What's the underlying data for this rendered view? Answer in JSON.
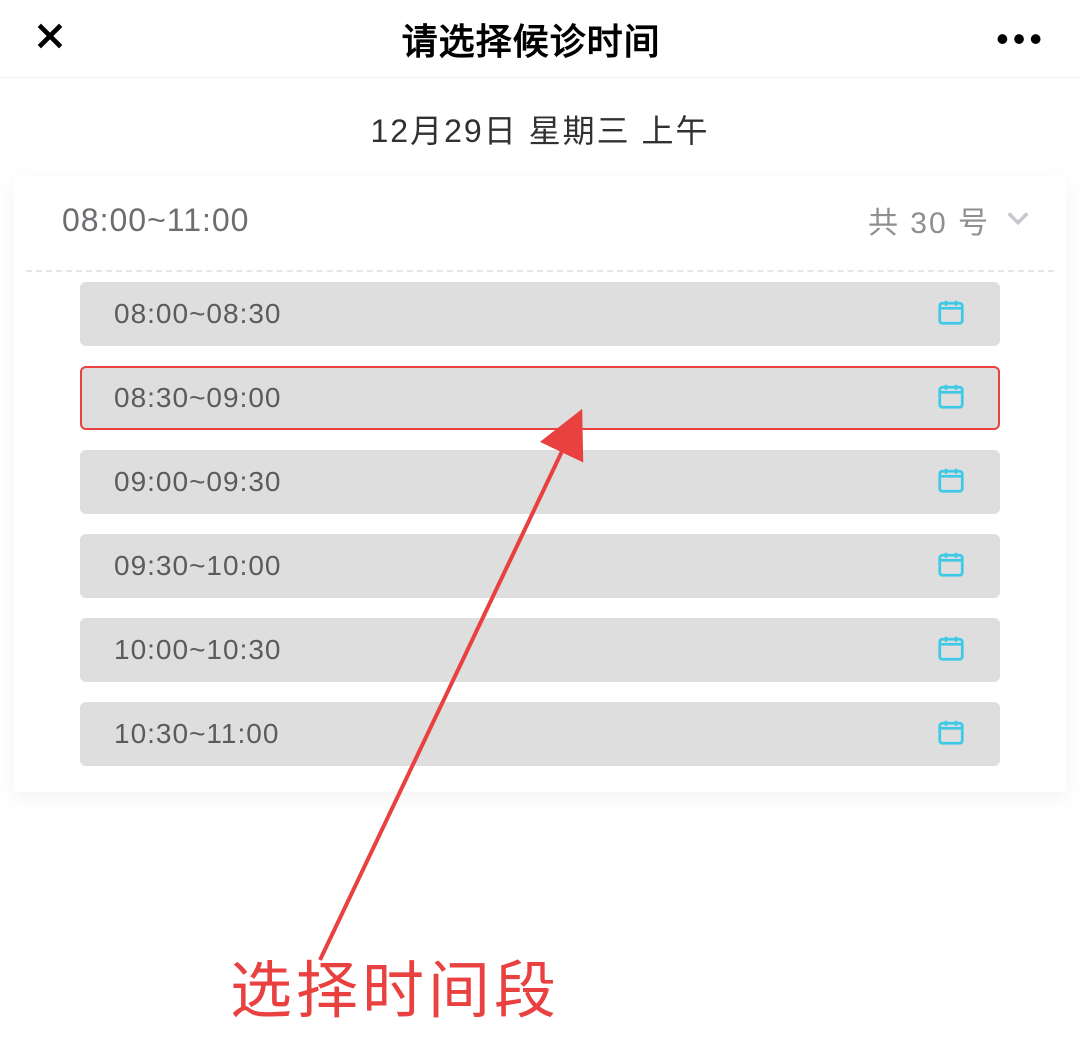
{
  "nav": {
    "title": "请选择候诊时间"
  },
  "date_line": "12月29日  星期三  上午",
  "range_row": {
    "range": "08:00~11:00",
    "count": "共 30 号"
  },
  "slots": [
    {
      "time": "08:00~08:30",
      "selected": false
    },
    {
      "time": "08:30~09:00",
      "selected": true
    },
    {
      "time": "09:00~09:30",
      "selected": false
    },
    {
      "time": "09:30~10:00",
      "selected": false
    },
    {
      "time": "10:00~10:30",
      "selected": false
    },
    {
      "time": "10:30~11:00",
      "selected": false
    }
  ],
  "annotation": {
    "caption": "选择时间段"
  }
}
